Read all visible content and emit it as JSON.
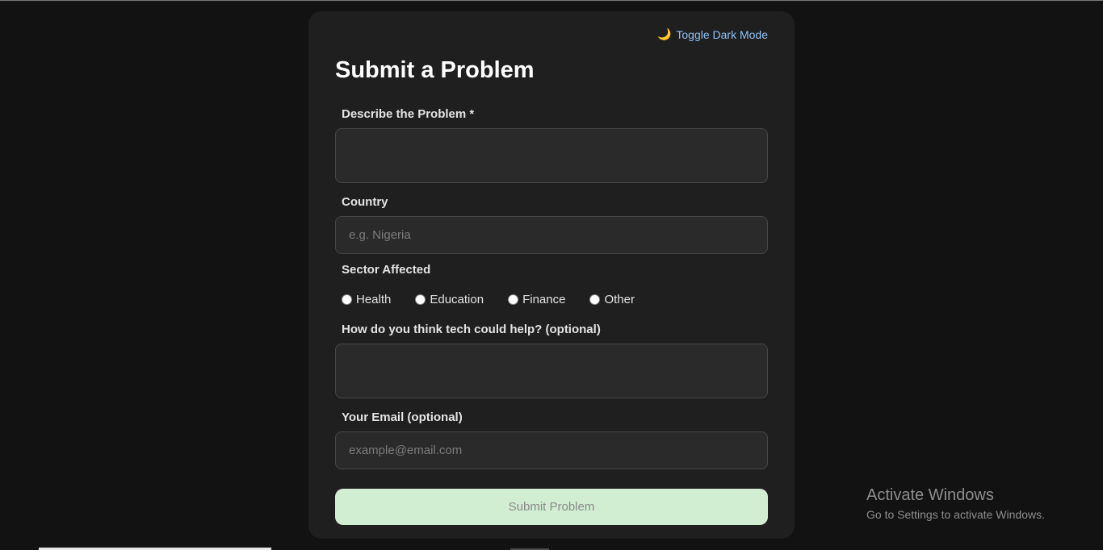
{
  "toggle": {
    "icon": "moon-icon",
    "label": "Toggle Dark Mode"
  },
  "form": {
    "title": "Submit a Problem",
    "problem": {
      "label": "Describe the Problem *",
      "value": "",
      "placeholder": ""
    },
    "country": {
      "label": "Country",
      "value": "",
      "placeholder": "e.g. Nigeria"
    },
    "sector": {
      "label": "Sector Affected",
      "options": [
        "Health",
        "Education",
        "Finance",
        "Other"
      ]
    },
    "tech_help": {
      "label": "How do you think tech could help? (optional)",
      "value": "",
      "placeholder": ""
    },
    "email": {
      "label": "Your Email (optional)",
      "value": "",
      "placeholder": "example@email.com"
    },
    "submit_label": "Submit Problem"
  },
  "watermark": {
    "title": "Activate Windows",
    "subtitle": "Go to Settings to activate Windows."
  },
  "colors": {
    "background": "#121212",
    "card": "#1f1f1f",
    "accent_link": "#8fc1f5",
    "submit_bg": "#d1edd2"
  }
}
